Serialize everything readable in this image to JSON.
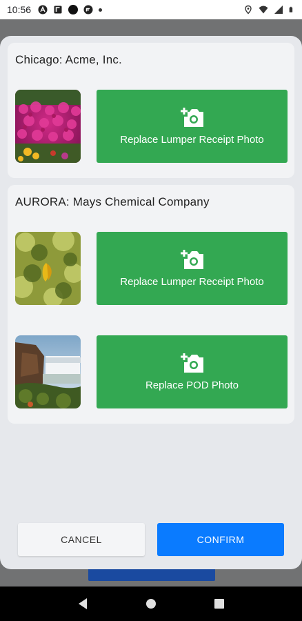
{
  "status_bar": {
    "time": "10:56",
    "left_icons": [
      "assistant-icon",
      "box-icon",
      "circle-icon",
      "cloud-icon",
      "dot-icon"
    ],
    "right_icons": [
      "location-icon",
      "wifi-icon",
      "signal-icon",
      "battery-icon"
    ]
  },
  "modal": {
    "cards": [
      {
        "title": "Chicago: Acme, Inc.",
        "rows": [
          {
            "thumbnail": "flowers-photo",
            "button_label": "Replace Lumper Receipt Photo"
          }
        ]
      },
      {
        "title": "AURORA: Mays Chemical Company",
        "rows": [
          {
            "thumbnail": "butterfly-photo",
            "button_label": "Replace Lumper Receipt Photo"
          },
          {
            "thumbnail": "waterfall-photo",
            "button_label": "Replace POD Photo"
          }
        ]
      }
    ],
    "cancel_label": "CANCEL",
    "confirm_label": "CONFIRM"
  },
  "colors": {
    "green_button": "#33a852",
    "confirm_button": "#0a7bff",
    "modal_background": "#e6e8ec"
  }
}
